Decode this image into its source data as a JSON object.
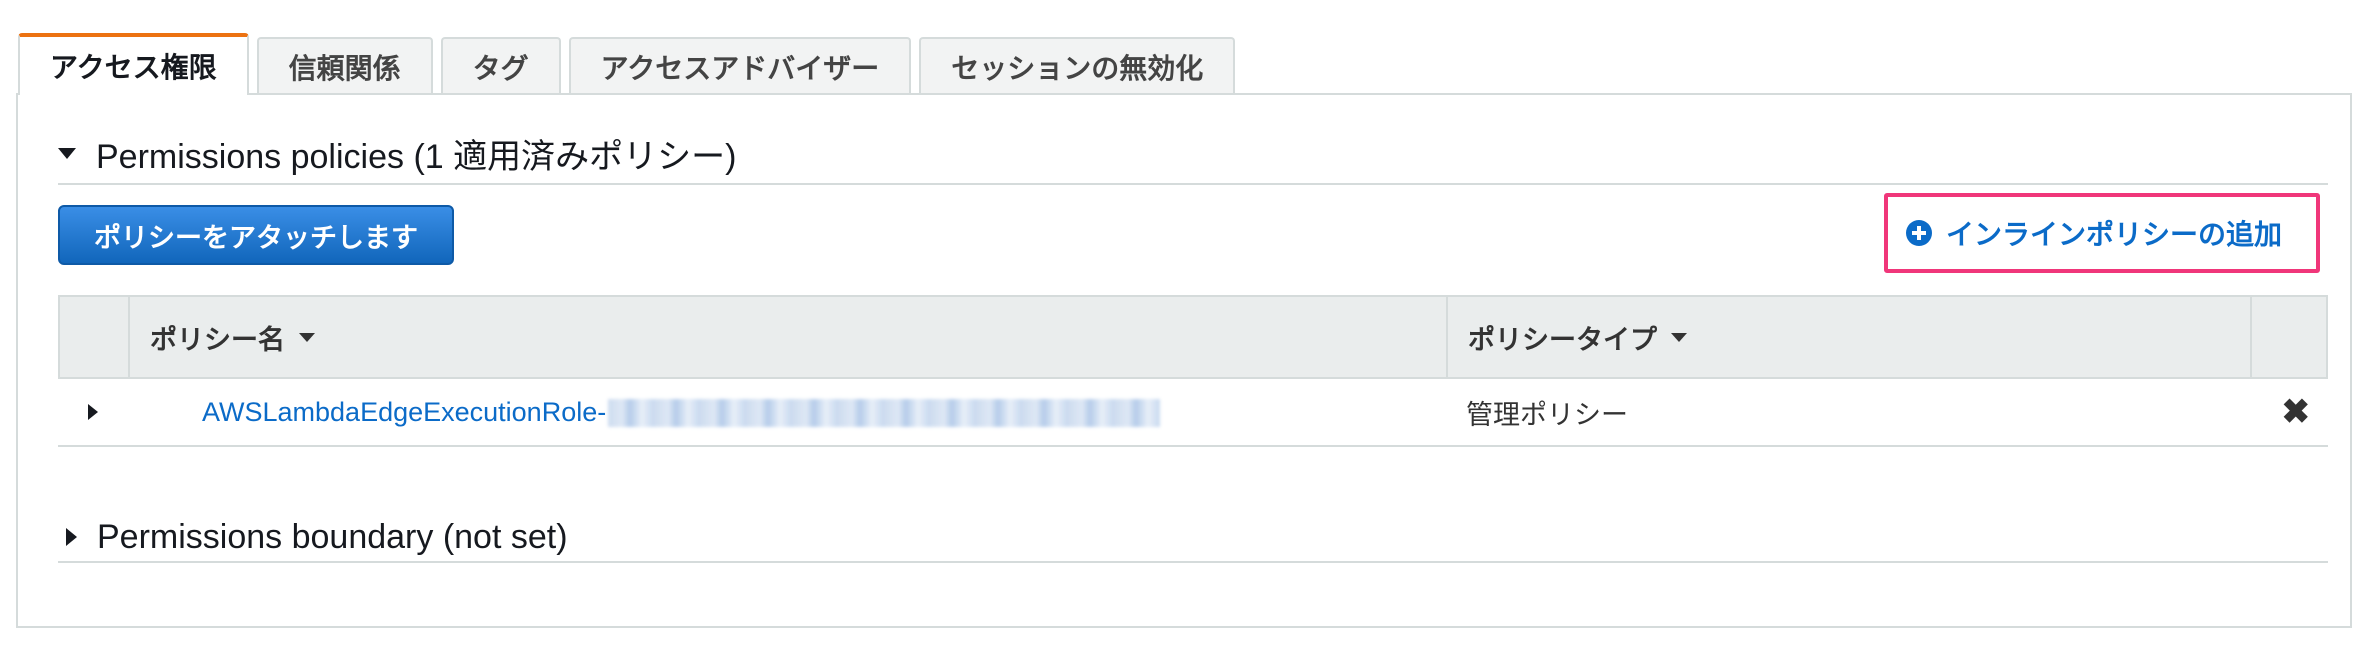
{
  "tabs": [
    {
      "label": "アクセス権限",
      "active": true
    },
    {
      "label": "信頼関係",
      "active": false
    },
    {
      "label": "タグ",
      "active": false
    },
    {
      "label": "アクセスアドバイザー",
      "active": false
    },
    {
      "label": "セッションの無効化",
      "active": false
    }
  ],
  "permissions": {
    "header": "Permissions policies (1 適用済みポリシー)",
    "attach_button": "ポリシーをアタッチします",
    "inline_policy_link": "インラインポリシーの追加",
    "table": {
      "columns": [
        "ポリシー名",
        "ポリシータイプ"
      ],
      "rows": [
        {
          "name": "AWSLambdaEdgeExecutionRole-",
          "type": "管理ポリシー",
          "delete_icon": "close-x-icon"
        }
      ]
    }
  },
  "boundary": {
    "header": "Permissions boundary (not set)"
  },
  "colors": {
    "accent_tab": "#ec7211",
    "primary_button": "#1166bb",
    "link": "#0b6bc8",
    "highlight_box": "#f0367a"
  }
}
